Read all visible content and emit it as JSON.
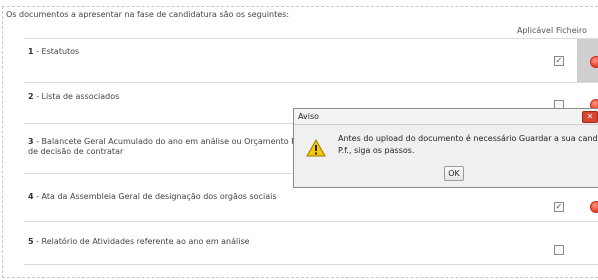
{
  "intro_text": "Os documentos a apresentar na fase de candidatura são os seguintes:",
  "columns": {
    "aplicavel": "Aplicável",
    "ficheiro": "Ficheiro"
  },
  "rows": [
    {
      "num": "1",
      "label": " - Estatutos",
      "label2": "",
      "checked": true,
      "check_mark": "✓"
    },
    {
      "num": "2",
      "label": " - Lista de associados",
      "label2": "",
      "checked": false,
      "check_mark": ""
    },
    {
      "num": "3",
      "label": " - Balancete Geral Acumulado do ano em análise ou Orçamento Previsio",
      "label2": "de decisão de contratar",
      "checked": true,
      "check_mark": "✓"
    },
    {
      "num": "4",
      "label": " - Ata da Assembleia Geral de designação dos orgãos sociais",
      "label2": "",
      "checked": true,
      "check_mark": "✓"
    },
    {
      "num": "5",
      "label": " - Relatório de Atividades referente ao ano em análise",
      "label2": "",
      "checked": false,
      "check_mark": ""
    }
  ],
  "dialog": {
    "title": "Aviso",
    "message_line1": "Antes do upload do documento é necessário Guardar a sua candidatura",
    "message_line2": "P.f., siga os passos.",
    "ok_label": "OK",
    "close_glyph": "✕",
    "icon": "warning-icon"
  },
  "colors": {
    "status_dot": "#f24a30",
    "ficheiro_highlight": "#cfcfcf",
    "close_button": "#d9442e"
  }
}
